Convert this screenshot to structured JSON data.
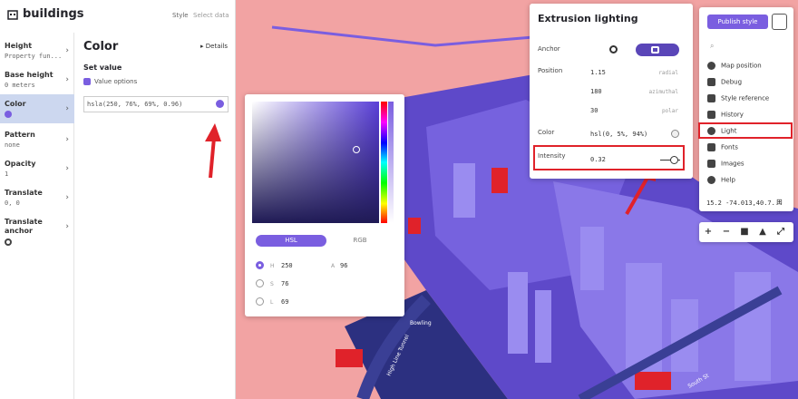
{
  "layer_panel": {
    "title": "buildings",
    "tabs": [
      "Style",
      "Select data"
    ],
    "properties": [
      {
        "name": "Height",
        "value": "Property fun..."
      },
      {
        "name": "Base height",
        "value": "0 meters"
      },
      {
        "name": "Color",
        "value": ""
      },
      {
        "name": "Pattern",
        "value": "none"
      },
      {
        "name": "Opacity",
        "value": "1"
      },
      {
        "name": "Translate",
        "value": "0, 0"
      },
      {
        "name": "Translate anchor",
        "value": ""
      }
    ],
    "editor": {
      "title": "Color",
      "details_label": "Details",
      "set_value_label": "Set value",
      "value_options_label": "Value options",
      "color_value": "hsla(250, 76%, 69%, 0.96)"
    }
  },
  "color_picker": {
    "tabs": [
      "HSL",
      "RGB"
    ],
    "values": [
      {
        "label": "H",
        "value": "250"
      },
      {
        "label": "S",
        "value": "76"
      },
      {
        "label": "L",
        "value": "69"
      }
    ],
    "alpha_label": "A",
    "alpha_value": "96"
  },
  "light_panel": {
    "title": "Extrusion lighting",
    "anchor_label": "Anchor",
    "position_label": "Position",
    "position": [
      {
        "value": "1.15",
        "unit": "radial"
      },
      {
        "value": "180",
        "unit": "azimuthal"
      },
      {
        "value": "30",
        "unit": "polar"
      }
    ],
    "color_label": "Color",
    "color_value": "hsl(0, 5%, 94%)",
    "intensity_label": "Intensity",
    "intensity_value": "0.32",
    "intensity_fraction": 0.32
  },
  "toolbar": {
    "publish_label": "Publish style",
    "items": [
      "Map position",
      "Debug",
      "Style reference",
      "History",
      "Light",
      "Fonts",
      "Images",
      "Help"
    ],
    "coords": "15.2   -74.013,40.7..."
  },
  "map_labels": [
    "Bowling",
    "High Line Tunnel",
    "South St"
  ],
  "colors": {
    "accent": "#7a5ee0",
    "building": "#6a52d4",
    "water": "#2a2f7a",
    "land": "#f0a0a0",
    "highlight": "#e0222a"
  }
}
